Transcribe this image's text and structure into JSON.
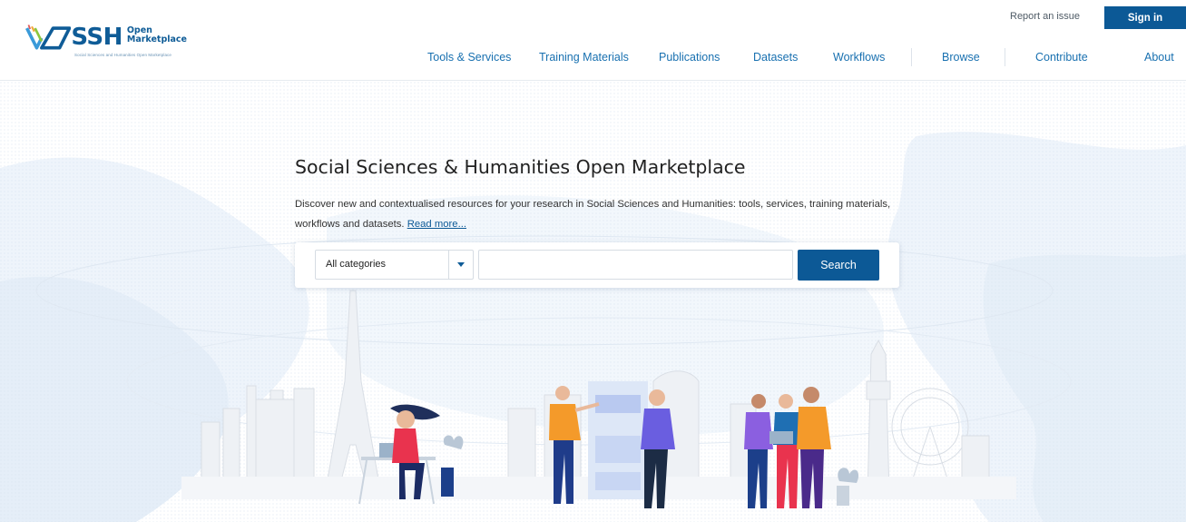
{
  "brand": {
    "logo_main": "SSH",
    "logo_line1": "Open",
    "logo_line2": "Marketplace",
    "logo_tagline": "Social Sciences and Humanities Open Marketplace",
    "primary_color": "#0c5996",
    "link_color": "#1870b0"
  },
  "header": {
    "report_issue": "Report an issue",
    "sign_in": "Sign in"
  },
  "nav": {
    "items": [
      {
        "label": "Tools & Services"
      },
      {
        "label": "Training Materials"
      },
      {
        "label": "Publications"
      },
      {
        "label": "Datasets"
      },
      {
        "label": "Workflows"
      },
      {
        "label": "Browse"
      },
      {
        "label": "Contribute"
      },
      {
        "label": "About"
      }
    ]
  },
  "hero": {
    "title": "Social Sciences & Humanities Open Marketplace",
    "description": "Discover new and contextualised resources for your research in Social Sciences and Humanities: tools, services, training materials, workflows and datasets.",
    "read_more": "Read more..."
  },
  "search": {
    "category_selected": "All categories",
    "query_value": "",
    "button_label": "Search",
    "caret_icon": "chevron-down-icon"
  }
}
